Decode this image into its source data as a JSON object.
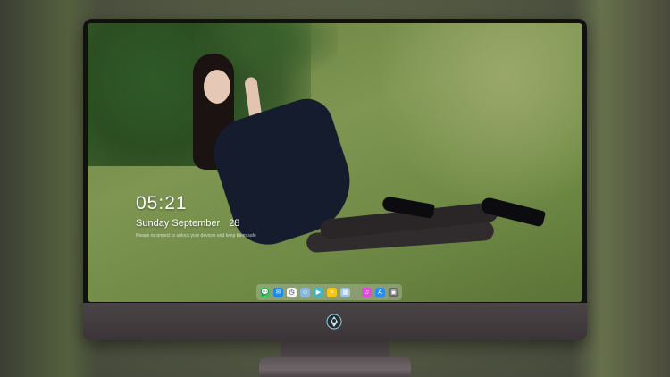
{
  "lockscreen": {
    "time": "05:21",
    "weekday_month": "Sunday September",
    "day": "28",
    "tagline": "Please reconnect to unlock your devices and keep them safe"
  },
  "dock": {
    "items": [
      {
        "name": "messages",
        "icon": "messages-icon",
        "color": "#34c759",
        "glyph": "💬"
      },
      {
        "name": "mail",
        "icon": "mail-icon",
        "color": "#1e88e5",
        "glyph": "✉"
      },
      {
        "name": "clock",
        "icon": "clock-icon",
        "color": "#f5f5f5",
        "glyph": "◷"
      },
      {
        "name": "finder",
        "icon": "finder-icon",
        "color": "#8bb7d8",
        "glyph": "☺"
      },
      {
        "name": "video",
        "icon": "video-icon",
        "color": "#3fb6c8",
        "glyph": "▶"
      },
      {
        "name": "notes",
        "icon": "notes-icon",
        "color": "#f5c518",
        "glyph": "≡"
      },
      {
        "name": "photos",
        "icon": "photos-icon",
        "color": "#9fc3e3",
        "glyph": "▦"
      },
      {
        "name": "music",
        "icon": "music-icon",
        "color": "#e04bd6",
        "glyph": "♫"
      },
      {
        "name": "app-store",
        "icon": "app-store-icon",
        "color": "#2a8cf0",
        "glyph": "A"
      },
      {
        "name": "trash",
        "icon": "trash-icon",
        "color": "#6b6b6b",
        "glyph": "▣"
      }
    ]
  },
  "colors": {
    "accent_text": "#ffffff",
    "bezel": "#111111",
    "chin": "#463f43"
  }
}
